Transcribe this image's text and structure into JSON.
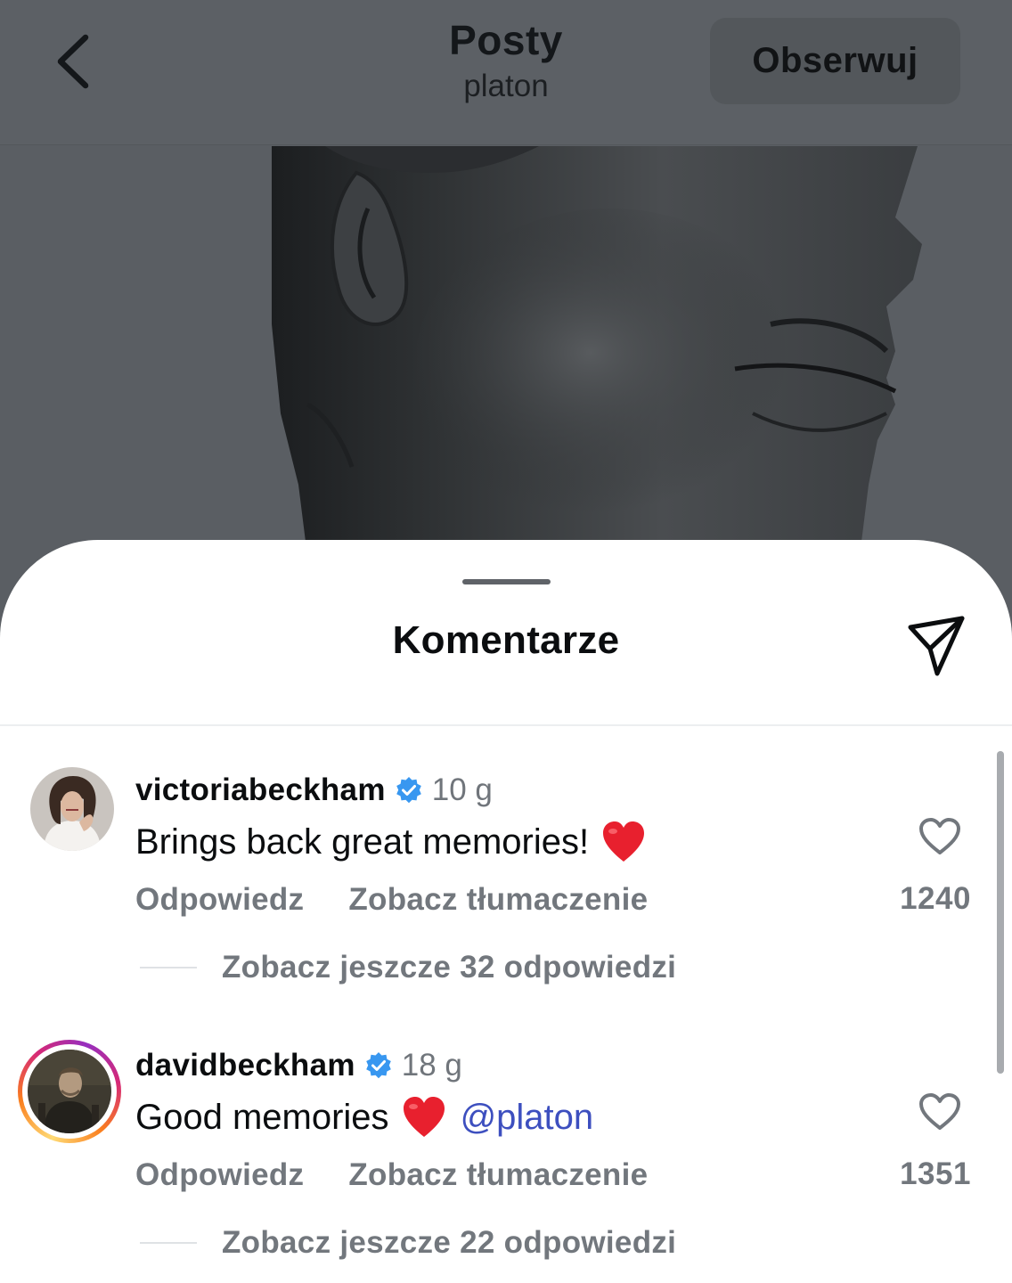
{
  "header": {
    "title": "Posty",
    "subtitle": "platon",
    "follow_label": "Obserwuj"
  },
  "sheet": {
    "title": "Komentarze"
  },
  "comments": [
    {
      "username": "victoriabeckham",
      "verified": true,
      "time": "10 g",
      "text": "Brings back great memories!",
      "emoji": "red-heart",
      "mention": "",
      "reply_label": "Odpowiedz",
      "translate_label": "Zobacz tłumaczenie",
      "replies_label": "Zobacz jeszcze 32 odpowiedzi",
      "likes": "1240",
      "story_ring": false
    },
    {
      "username": "davidbeckham",
      "verified": true,
      "time": "18 g",
      "text": "Good memories",
      "emoji": "red-heart",
      "mention": "@platon",
      "reply_label": "Odpowiedz",
      "translate_label": "Zobacz tłumaczenie",
      "replies_label": "Zobacz jeszcze 22 odpowiedzi",
      "likes": "1351",
      "story_ring": true
    }
  ],
  "icons": {
    "back": "chevron-left-icon",
    "share": "paper-plane-icon",
    "verified": "verified-badge-icon",
    "like": "heart-outline-icon"
  },
  "colors": {
    "verified_blue": "#3897f0",
    "mention_blue": "#3d4fbf",
    "heart_red": "#e8202e",
    "overlay_gray": "#5c6065"
  }
}
